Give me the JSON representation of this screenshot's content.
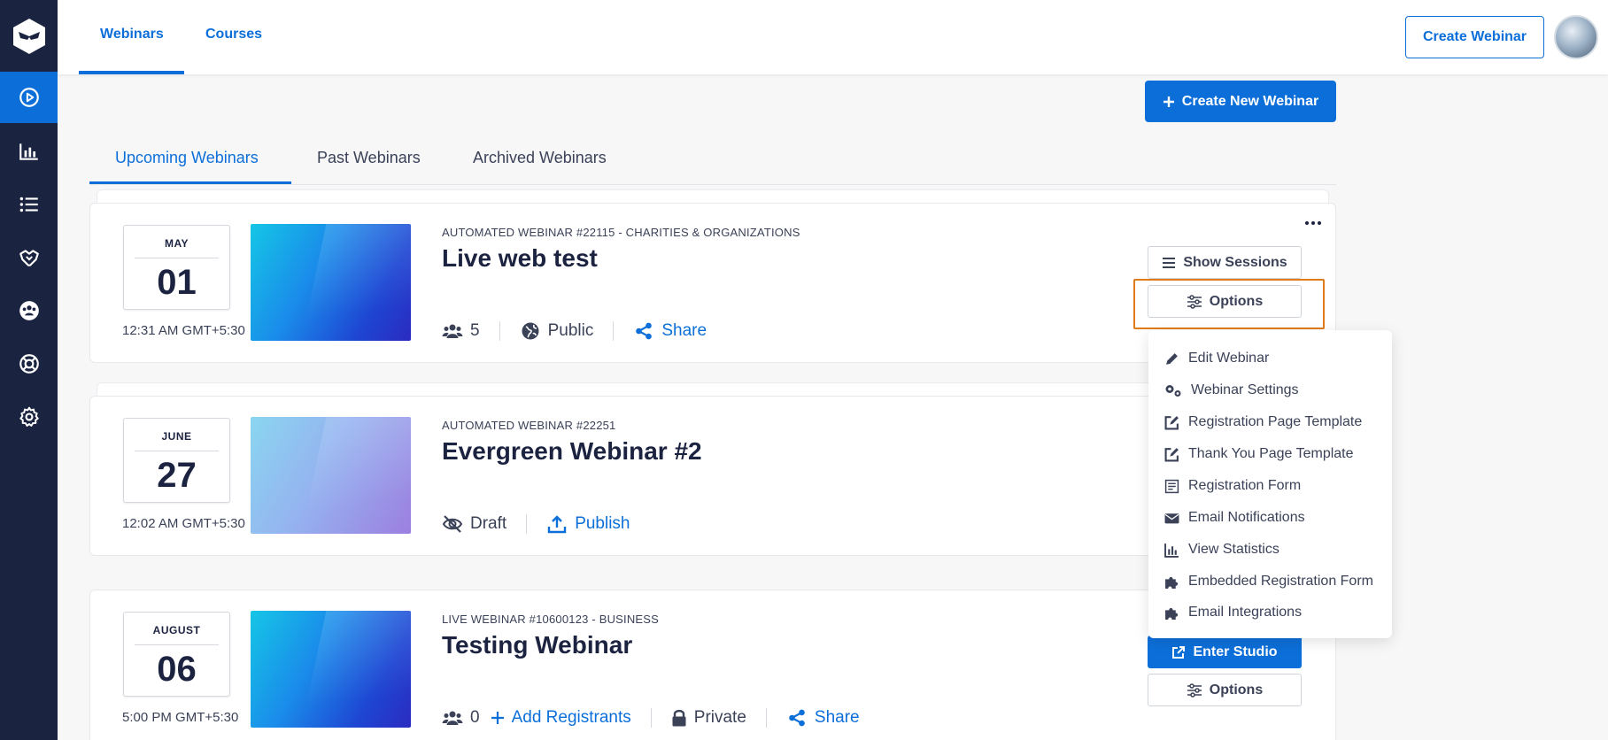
{
  "top_nav": {
    "tabs": [
      {
        "label": "Webinars"
      },
      {
        "label": "Courses"
      }
    ],
    "create_webinar_label": "Create Webinar"
  },
  "create_new_webinar_label": "Create New Webinar",
  "list_tabs": [
    {
      "label": "Upcoming Webinars"
    },
    {
      "label": "Past Webinars"
    },
    {
      "label": "Archived Webinars"
    }
  ],
  "webinars": [
    {
      "month": "MAY",
      "day": "01",
      "time": "12:31 AM GMT+5:30",
      "subtitle": "AUTOMATED WEBINAR #22115 - CHARITIES & ORGANIZATIONS",
      "title": "Live web test",
      "registrants": "5",
      "visibility": "Public",
      "share_label": "Share",
      "show_sessions_label": "Show Sessions",
      "options_label": "Options"
    },
    {
      "month": "JUNE",
      "day": "27",
      "time": "12:02 AM GMT+5:30",
      "subtitle": "AUTOMATED WEBINAR #22251",
      "title": "Evergreen Webinar #2",
      "status": "Draft",
      "publish_label": "Publish"
    },
    {
      "month": "AUGUST",
      "day": "06",
      "time": "5:00 PM GMT+5:30",
      "subtitle": "LIVE WEBINAR #10600123 - BUSINESS",
      "title": "Testing Webinar",
      "registrants": "0",
      "add_registrants_label": "Add Registrants",
      "visibility": "Private",
      "share_label": "Share",
      "enter_studio_label": "Enter Studio",
      "options_label": "Options"
    }
  ],
  "options_menu": [
    {
      "label": "Edit Webinar",
      "icon": "pencil-icon"
    },
    {
      "label": "Webinar Settings",
      "icon": "gears-icon"
    },
    {
      "label": "Registration Page Template",
      "icon": "edit-square-icon"
    },
    {
      "label": "Thank You Page Template",
      "icon": "edit-square-icon"
    },
    {
      "label": "Registration Form",
      "icon": "form-icon"
    },
    {
      "label": "Email Notifications",
      "icon": "envelope-icon"
    },
    {
      "label": "View Statistics",
      "icon": "bar-chart-icon"
    },
    {
      "label": "Embedded Registration Form",
      "icon": "puzzle-icon"
    },
    {
      "label": "Email Integrations",
      "icon": "puzzle-icon"
    }
  ],
  "colors": {
    "sidebar": "#1a2340",
    "accent": "#0c6fd9",
    "highlight": "#e07b1a"
  }
}
